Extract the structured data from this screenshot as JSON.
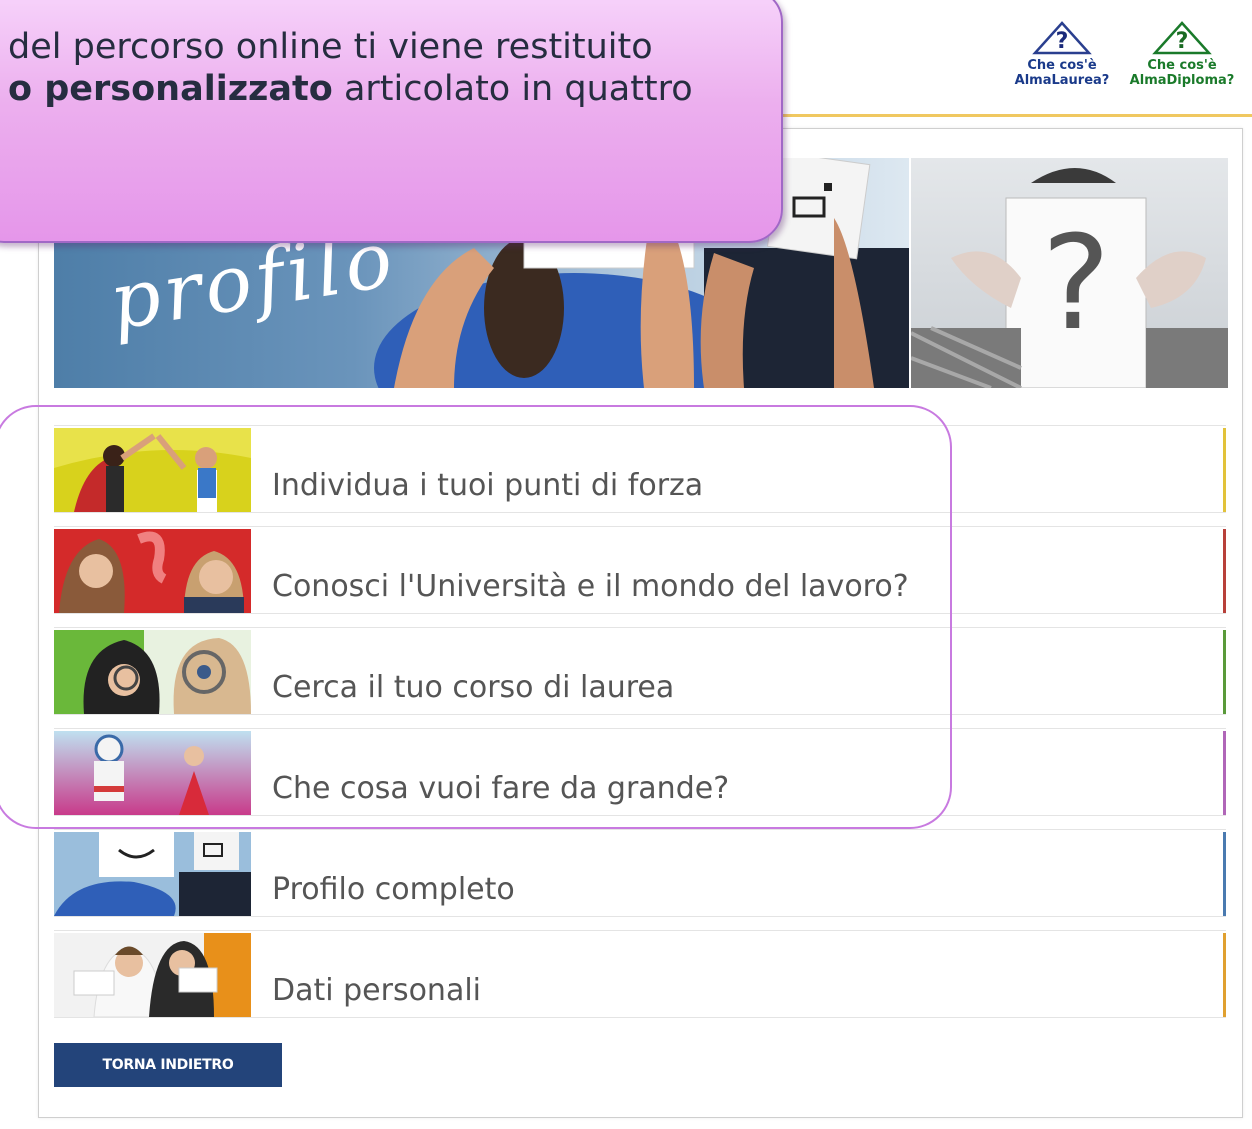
{
  "header": {
    "help_links": [
      {
        "line1": "Che cos'è",
        "line2": "AlmaLaurea?",
        "color": "#1a3a8a"
      },
      {
        "line1": "Che cos'è",
        "line2": "AlmaDiploma?",
        "color": "#1a7a2a"
      }
    ]
  },
  "hero": {
    "title": "profilo"
  },
  "menu": [
    {
      "label": "Individua i tuoi punti di forza",
      "accent": "#e2c23a"
    },
    {
      "label": "Conosci l'Università e il mondo del lavoro?",
      "accent": "#b8403a"
    },
    {
      "label": "Cerca il tuo corso di laurea",
      "accent": "#5a9a3a"
    },
    {
      "label": "Che cosa vuoi fare da grande?",
      "accent": "#b066b8"
    },
    {
      "label": "Profilo completo",
      "accent": "#4a7ab0"
    },
    {
      "label": "Dati personali",
      "accent": "#e0a030"
    }
  ],
  "back_button": "TORNA INDIETRO",
  "callout": {
    "line1": "del percorso online ti viene restituito",
    "line2_bold": "o personalizzato",
    "line2_rest": " articolato in quattro"
  }
}
